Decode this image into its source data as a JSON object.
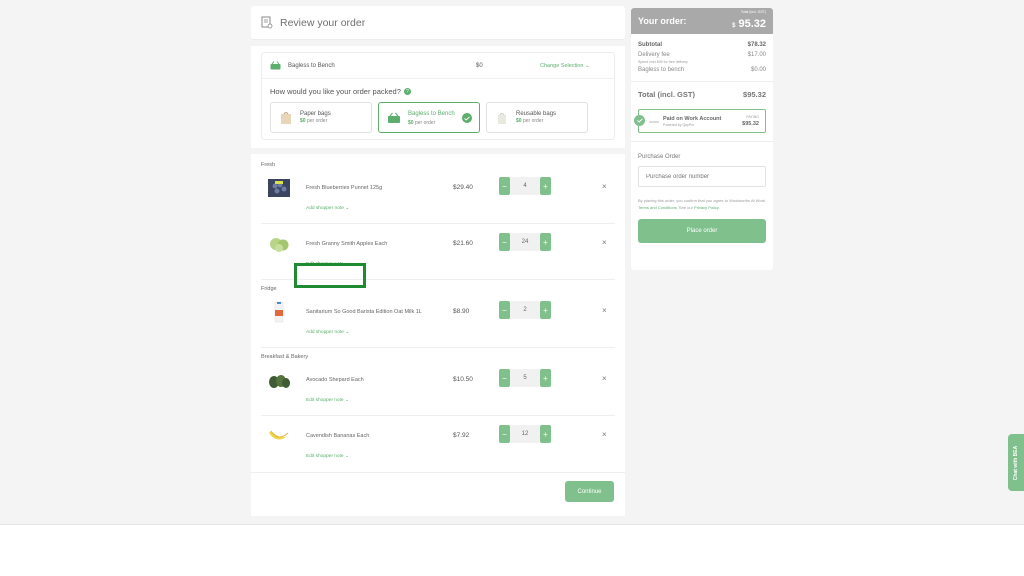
{
  "review": {
    "title": "Review your order"
  },
  "packing": {
    "selection_label": "Bagless to Bench",
    "selection_price": "$0",
    "change_label": "Change Selection",
    "question": "How would you like your order packed?",
    "options": [
      {
        "name": "Paper bags",
        "price": "$0",
        "suffix": "per order",
        "selected": false
      },
      {
        "name": "Bagless to Bench",
        "price": "$0",
        "suffix": "per order",
        "selected": true
      },
      {
        "name": "Reusable bags",
        "price": "$0",
        "suffix": "per order",
        "selected": false
      }
    ]
  },
  "categories": {
    "fresh": "Fresh",
    "fridge": "Fridge",
    "breakfast": "Breakfast & Bakery"
  },
  "items": [
    {
      "name": "Fresh Blueberries Punnet 125g",
      "price": "$29.40",
      "qty": "4",
      "note": "Add shopper note"
    },
    {
      "name": "Fresh Granny Smith Apples Each",
      "price": "$21.60",
      "qty": "24",
      "note": "Edit shopper note"
    },
    {
      "name": "Sanitarium So Good Barista Edition Oat Milk 1L",
      "price": "$8.90",
      "qty": "2",
      "note": "Add shopper note"
    },
    {
      "name": "Avocado Shepard Each",
      "price": "$10.50",
      "qty": "5",
      "note": "Edit shopper note"
    },
    {
      "name": "Cavendish Bananas Each",
      "price": "$7.92",
      "qty": "12",
      "note": "Edit shopper note"
    }
  ],
  "controls": {
    "minus": "−",
    "plus": "+",
    "remove": "×",
    "chevron": "⌄"
  },
  "continue_label": "Continue",
  "summary": {
    "title": "Your order:",
    "total_incl_label": "Total (incl. GST)",
    "currency": "$",
    "big_total": "95.32",
    "subtotal_label": "Subtotal",
    "subtotal": "$78.32",
    "delivery_label": "Delivery fee",
    "delivery": "$17.00",
    "delivery_note": "Spend over $99 for free delivery",
    "bagless_label": "Bagless to bench",
    "bagless": "$0.00",
    "total_label": "Total (incl. GST)",
    "total": "$95.32"
  },
  "payment": {
    "title": "Paid on Work Account",
    "subtitle": "Powered by QayPro",
    "paying_label": "PAYING",
    "amount": "$95.32"
  },
  "purchase_order": {
    "label": "Purchase Order",
    "placeholder": "Purchase order number"
  },
  "legal": {
    "text1": "By placing this order, you confirm that you agree to Woolworths At Work ",
    "link1": "Terms and Conditions",
    "text2": ". See our ",
    "link2": "Privacy Policy",
    "text3": "."
  },
  "place_order_label": "Place order",
  "chat_label": "Chat with BEA",
  "colors": {
    "accent": "#5cae6c",
    "button": "#7fc08d",
    "highlight": "#1e8a32",
    "header_grey": "#a9a9a9"
  }
}
